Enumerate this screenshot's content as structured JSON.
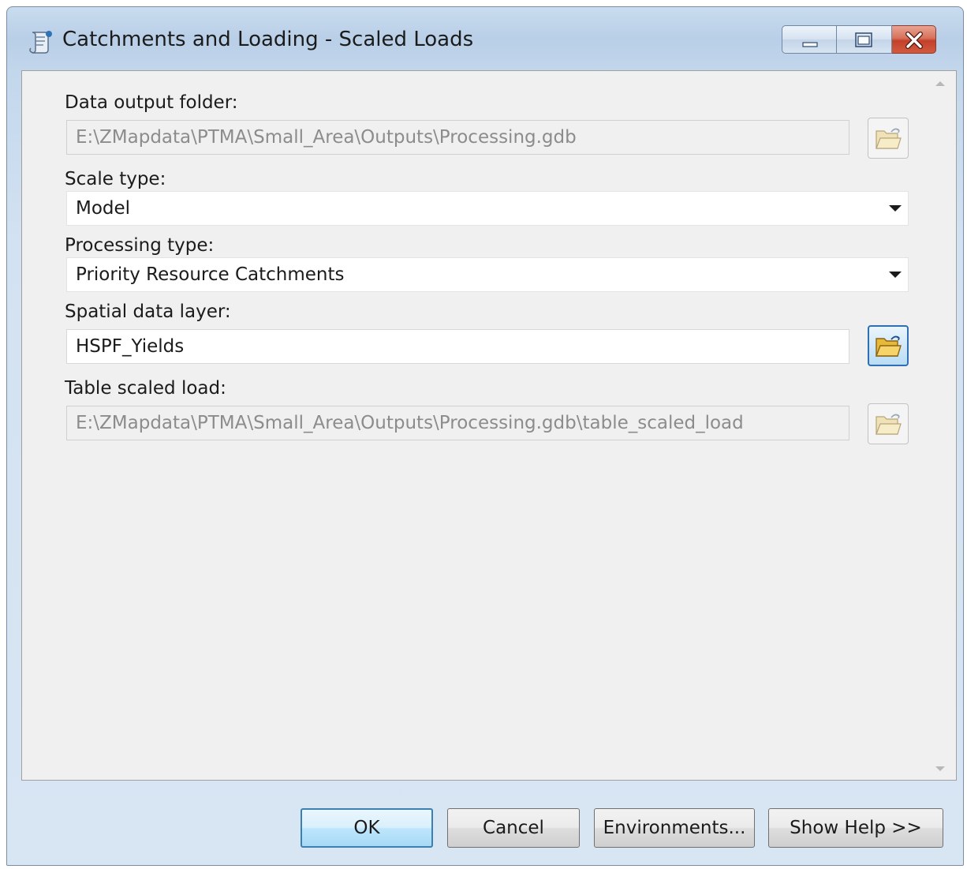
{
  "window": {
    "title": "Catchments and Loading - Scaled Loads"
  },
  "form": {
    "data_output_folder": {
      "label": "Data output folder:",
      "value": "E:\\ZMapdata\\PTMA\\Small_Area\\Outputs\\Processing.gdb",
      "enabled": false
    },
    "scale_type": {
      "label": "Scale type:",
      "value": "Model"
    },
    "processing_type": {
      "label": "Processing type:",
      "value": "Priority Resource Catchments"
    },
    "spatial_data_layer": {
      "label": "Spatial data layer:",
      "value": "HSPF_Yields",
      "enabled": true
    },
    "table_scaled_load": {
      "label": "Table scaled load:",
      "value": "E:\\ZMapdata\\PTMA\\Small_Area\\Outputs\\Processing.gdb\\table_scaled_load",
      "enabled": false
    }
  },
  "buttons": {
    "ok": "OK",
    "cancel": "Cancel",
    "environments": "Environments...",
    "show_help": "Show Help >>"
  },
  "icons": {
    "app": "toolbox-script-icon",
    "browse": "open-folder-icon",
    "minimize": "minimize-icon",
    "maximize": "maximize-icon",
    "close": "close-icon"
  },
  "colors": {
    "title_bar": "#c3d7ec",
    "client_background": "#f0f0f0",
    "close_button": "#c3402a",
    "focus_border": "#3c7fb1"
  }
}
